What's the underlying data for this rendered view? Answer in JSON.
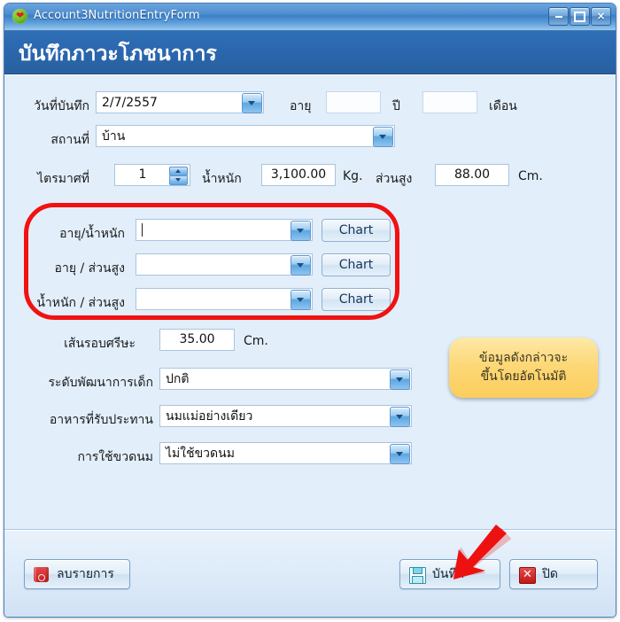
{
  "window": {
    "title": "Account3NutritionEntryForm",
    "app_icon": "heart-in-circle-icon",
    "controls": {
      "minimize": "minimize-icon",
      "maximize": "maximize-icon",
      "close": "×"
    }
  },
  "header": {
    "title": "บันทึกภาวะโภชนาการ"
  },
  "form": {
    "date": {
      "label": "วันที่บันทึก",
      "value": "2/7/2557"
    },
    "age": {
      "label": "อายุ",
      "years_value": "",
      "years_unit": "ปี",
      "months_value": "",
      "months_unit": "เดือน"
    },
    "place": {
      "label": "สถานที่",
      "value": "บ้าน"
    },
    "quarter": {
      "label": "ไตรมาศที่",
      "value": "1"
    },
    "weight": {
      "label": "น้ำหนัก",
      "value": "3,100.00",
      "unit": "Kg."
    },
    "height": {
      "label": "ส่วนสูง",
      "value": "88.00",
      "unit": "Cm."
    },
    "chart_rows": [
      {
        "label": "อายุ/น้ำหนัก",
        "value": "",
        "button": "Chart"
      },
      {
        "label": "อายุ / ส่วนสูง",
        "value": "",
        "button": "Chart"
      },
      {
        "label": "น้ำหนัก / ส่วนสูง",
        "value": "",
        "button": "Chart"
      }
    ],
    "head_circumference": {
      "label": "เส้นรอบศรีษะ",
      "value": "35.00",
      "unit": "Cm."
    },
    "development_level": {
      "label": "ระดับพัฒนาการเด็ก",
      "value": "ปกติ"
    },
    "food_intake": {
      "label": "อาหารที่รับประทาน",
      "value": "นมแม่อย่างเดียว"
    },
    "bottle_use": {
      "label": "การใช้ขวดนม",
      "value": "ไม่ใช้ขวดนม"
    }
  },
  "footer": {
    "delete_label": "ลบรายการ",
    "delete_icon": "trash-icon",
    "save_label": "บันทึก",
    "save_icon": "floppy-disk-icon",
    "close_label": "ปิด",
    "close_icon": "red-x-icon"
  },
  "annotations": {
    "callout_line1": "ข้อมูลดังกล่าวจะ",
    "callout_line2": "ขึ้นโดยอัตโนมัติ",
    "highlight_color": "#f01212",
    "callout_color": "#fbcd5c",
    "arrow_color": "#ee1111"
  }
}
